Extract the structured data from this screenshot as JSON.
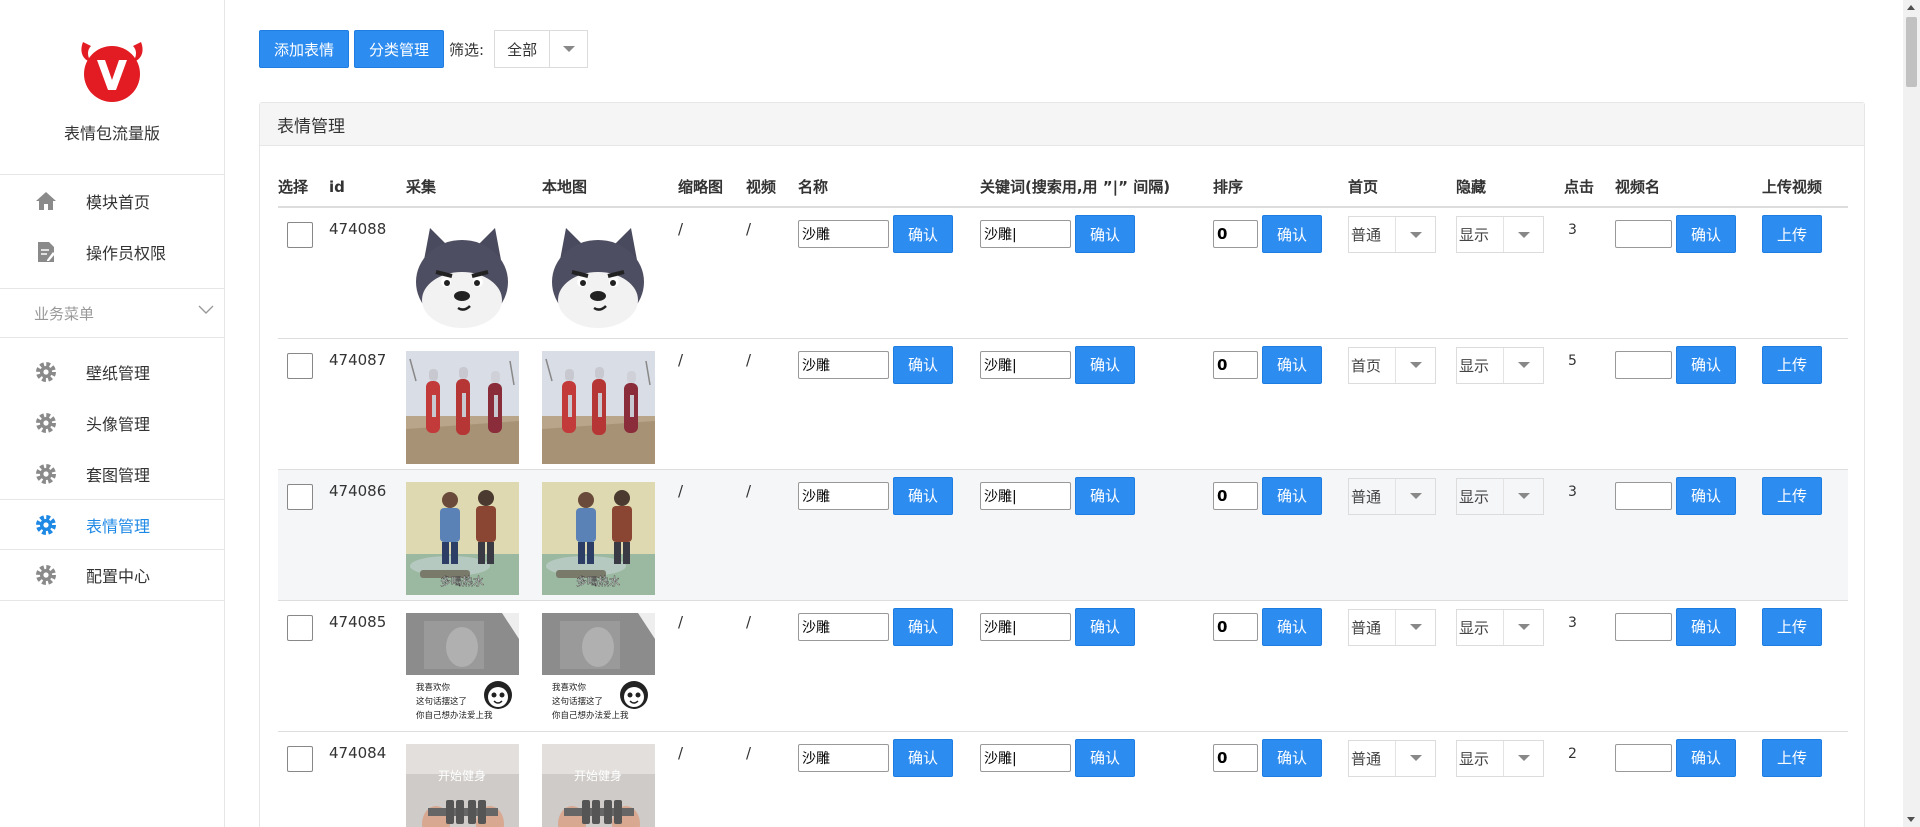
{
  "sidebar": {
    "app_title": "表情包流量版",
    "top_items": [
      {
        "label": "模块首页",
        "icon": "home-icon"
      },
      {
        "label": "操作员权限",
        "icon": "document-edit-icon"
      }
    ],
    "group_label": "业务菜单",
    "group_items": [
      {
        "label": "壁纸管理",
        "icon": "gear-icon",
        "active": false
      },
      {
        "label": "头像管理",
        "icon": "gear-icon",
        "active": false
      },
      {
        "label": "套图管理",
        "icon": "gear-icon",
        "active": false
      },
      {
        "label": "表情管理",
        "icon": "gear-icon",
        "active": true
      },
      {
        "label": "配置中心",
        "icon": "gear-icon",
        "active": false
      }
    ],
    "accent_color": "#e31c23",
    "active_color": "#1e88e5"
  },
  "toolbar": {
    "add_label": "添加表情",
    "category_label": "分类管理",
    "filter_label": "筛选:",
    "filter_value": "全部"
  },
  "panel": {
    "title": "表情管理",
    "columns": [
      "选择",
      "id",
      "采集",
      "本地图",
      "缩略图",
      "视频",
      "名称",
      "关键词(搜索用,用 ”|” 间隔)",
      "排序",
      "首页",
      "隐藏",
      "点击",
      "视频名",
      "上传视频"
    ],
    "confirm_label": "确认",
    "upload_label": "上传",
    "rows": [
      {
        "id": "474088",
        "thumb": "/",
        "video": "/",
        "name": "沙雕",
        "keywords": "沙雕|",
        "sort": "0",
        "home": "普通",
        "hidden": "显示",
        "clicks": "3",
        "video_name": "",
        "image": "husky-dog"
      },
      {
        "id": "474087",
        "thumb": "/",
        "video": "/",
        "name": "沙雕",
        "keywords": "沙雕|",
        "sort": "0",
        "home": "首页",
        "hidden": "显示",
        "clicks": "5",
        "video_name": "",
        "image": "heroes"
      },
      {
        "id": "474086",
        "thumb": "/",
        "video": "/",
        "name": "沙雕",
        "keywords": "沙雕|",
        "sort": "0",
        "home": "普通",
        "hidden": "显示",
        "clicks": "3",
        "video_name": "",
        "image": "two-men",
        "caption": "多喝热水"
      },
      {
        "id": "474085",
        "thumb": "/",
        "video": "/",
        "name": "沙雕",
        "keywords": "沙雕|",
        "sort": "0",
        "home": "普通",
        "hidden": "显示",
        "clicks": "3",
        "video_name": "",
        "image": "panda-meme",
        "caption_lines": [
          "我喜欢你",
          "这句话摆这了",
          "你自己想办法爱上我"
        ]
      },
      {
        "id": "474084",
        "thumb": "/",
        "video": "/",
        "name": "沙雕",
        "keywords": "沙雕|",
        "sort": "0",
        "home": "普通",
        "hidden": "显示",
        "clicks": "2",
        "video_name": "",
        "image": "dumbbell",
        "caption": "开始健身"
      }
    ]
  }
}
